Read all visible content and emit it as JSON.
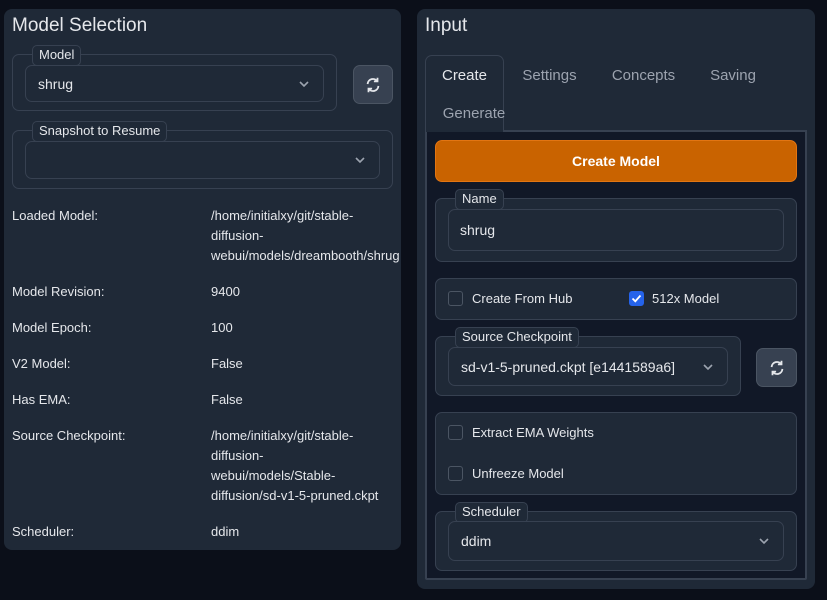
{
  "left": {
    "title": "Model Selection",
    "model": {
      "legend": "Model",
      "value": "shrug"
    },
    "snapshot": {
      "legend": "Snapshot to Resume",
      "value": ""
    },
    "info": [
      {
        "label": "Loaded Model:",
        "value_lines": [
          "/home/initialxy/git/stable-",
          "diffusion-",
          "webui/models/dreambooth/shrug"
        ]
      },
      {
        "label": "Model Revision:",
        "value_lines": [
          "9400"
        ]
      },
      {
        "label": "Model Epoch:",
        "value_lines": [
          "100"
        ]
      },
      {
        "label": "V2 Model:",
        "value_lines": [
          "False"
        ]
      },
      {
        "label": "Has EMA:",
        "value_lines": [
          "False"
        ]
      },
      {
        "label": "Source Checkpoint:",
        "value_lines": [
          "/home/initialxy/git/stable-",
          "diffusion-",
          "webui/models/Stable-",
          "diffusion/sd-v1-5-pruned.ckpt"
        ]
      },
      {
        "label": "Scheduler:",
        "value_lines": [
          "ddim"
        ]
      }
    ]
  },
  "right": {
    "title": "Input",
    "tabs": [
      "Create",
      "Settings",
      "Concepts",
      "Saving",
      "Generate"
    ],
    "create_button": "Create Model",
    "name": {
      "legend": "Name",
      "value": "shrug"
    },
    "create_from_hub": {
      "label": "Create From Hub",
      "checked": false
    },
    "model_512x": {
      "label": "512x Model",
      "checked": true
    },
    "source_checkpoint": {
      "legend": "Source Checkpoint",
      "value": "sd-v1-5-pruned.ckpt [e1441589a6]"
    },
    "extract_ema": {
      "label": "Extract EMA Weights",
      "checked": false
    },
    "unfreeze_model": {
      "label": "Unfreeze Model",
      "checked": false
    },
    "scheduler": {
      "legend": "Scheduler",
      "value": "ddim"
    }
  },
  "colors": {
    "accent": "#c96300",
    "checkbox_checked": "#2563eb",
    "panel": "#1f2937",
    "background": "#0b0f19"
  },
  "icons": {
    "refresh": "refresh-icon",
    "chevron": "chevron-down-icon",
    "check": "check-icon"
  }
}
